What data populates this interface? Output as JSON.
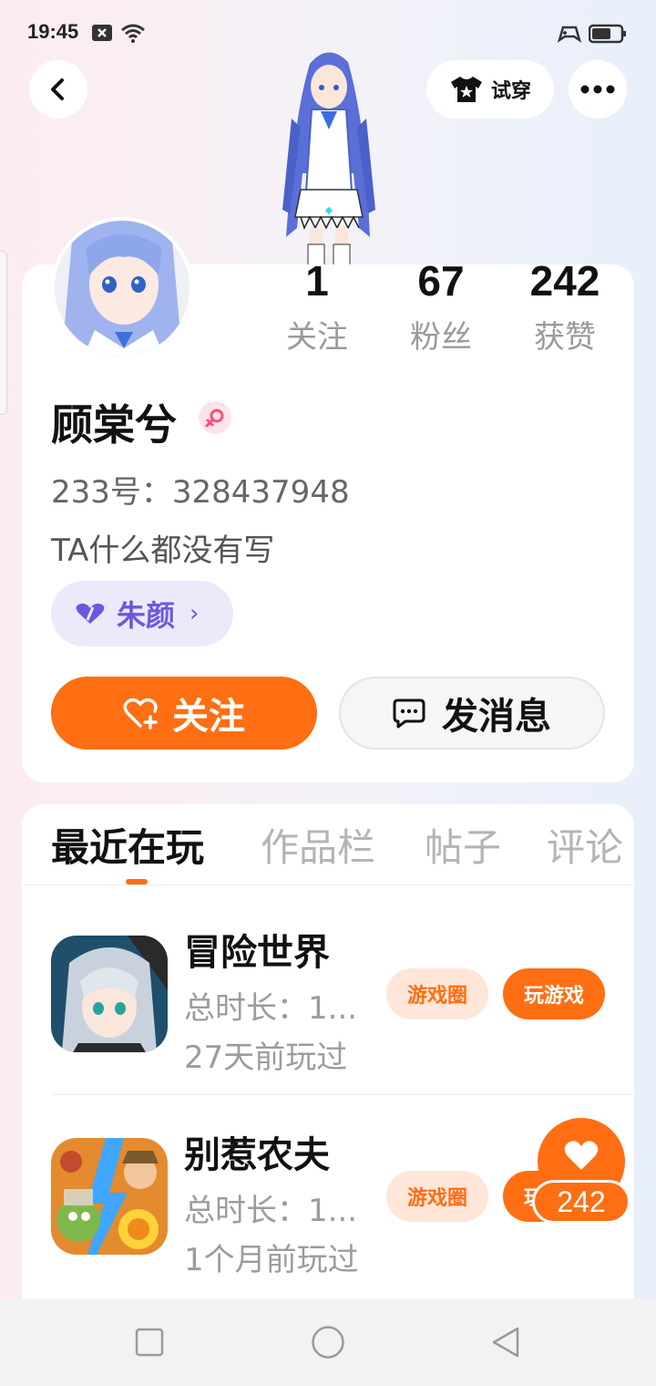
{
  "status_bar": {
    "time": "19:45",
    "icons": [
      "notification-x-icon",
      "wifi-icon",
      "game-controller-icon",
      "battery-icon"
    ]
  },
  "header": {
    "back_icon": "chevron-left-icon",
    "try_on_label": "试穿",
    "try_on_icon": "shirt-icon",
    "more_icon": "more-dots-icon"
  },
  "profile": {
    "name": "顾棠兮",
    "gender_icon": "female-icon",
    "uid_label": "233号：328437948",
    "bio": "TA什么都没有写",
    "tag": {
      "label": "朱颜",
      "icon": "purple-heart-icon"
    },
    "stats": [
      {
        "value": "1",
        "label": "关注"
      },
      {
        "value": "67",
        "label": "粉丝"
      },
      {
        "value": "242",
        "label": "获赞"
      }
    ],
    "follow_label": "关注",
    "message_label": "发消息"
  },
  "tabs": [
    "最近在玩",
    "作品栏",
    "帖子",
    "评论"
  ],
  "games": [
    {
      "title": "冒险世界",
      "playtime": "总时长：1...",
      "last_played": "27天前玩过",
      "circle_label": "游戏圈",
      "play_label": "玩游戏"
    },
    {
      "title": "别惹农夫",
      "playtime": "总时长：1...",
      "last_played": "1个月前玩过",
      "circle_label": "游戏圈",
      "play_label": "玩游戏"
    }
  ],
  "floating_like": {
    "count": "242",
    "icon": "heart-icon"
  },
  "nav": {
    "icons": [
      "recent-apps-icon",
      "home-icon",
      "back-triangle-icon"
    ]
  },
  "colors": {
    "accent": "#ff6e12",
    "tag_purple": "#6d57e0"
  }
}
